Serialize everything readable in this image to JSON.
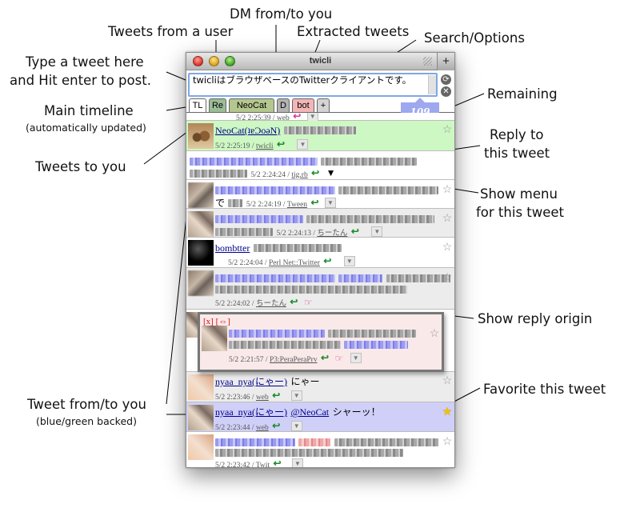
{
  "window": {
    "title": "twicli",
    "add_button": "+",
    "compose_text": "twicliはブラウザベースのTwitterクライアントです。",
    "remaining": "109"
  },
  "tabs": [
    "TL",
    "Re",
    "NeoCat",
    "D",
    "bot",
    "+"
  ],
  "tweets": [
    {
      "meta": "5/2 2:25:39",
      "source": "web"
    },
    {
      "name": "NeoCat(ʇɐƆoǝN)",
      "meta": "5/2 2:25:19",
      "source": "twicli"
    },
    {
      "meta": "5/2 2:24:24",
      "source": "tig.rb"
    },
    {
      "meta": "5/2 2:24:19",
      "source": "Tween",
      "prefix": "で"
    },
    {
      "meta": "5/2 2:24:13",
      "source": "ちーたん"
    },
    {
      "name": "bombtter",
      "meta": "5/2 2:24:04",
      "source": "Perl Net::Twitter"
    },
    {
      "meta": "5/2 2:24:02",
      "source": "ちーたん"
    },
    {
      "meta": "5/2 2:21:57",
      "source": "P3:PeraPeraPrv"
    },
    {
      "name": "nyaa_nya(にゃー)",
      "text": "にゃー",
      "meta": "5/2 2:23:46",
      "source": "web"
    },
    {
      "name": "nyaa_nya(にゃー)",
      "mention": "@NeoCat",
      "text": "シャーッ！",
      "meta": "5/2 2:23:44",
      "source": "web"
    },
    {
      "meta": "5/2 2:23:42",
      "source": "Twit"
    }
  ],
  "popup": {
    "close": "[x]",
    "toggle": "[⇔]"
  },
  "callouts": {
    "dm": "DM from/to you",
    "user_tweets": "Tweets from a user",
    "extracted": "Extracted tweets",
    "search": "Search/Options",
    "type_line1": "Type a tweet here",
    "type_line2": "and Hit enter to post.",
    "remaining": "Remaining",
    "main_timeline": "Main timeline",
    "auto_updated": "(automatically updated)",
    "reply_line1": "Reply to",
    "reply_line2": "this tweet",
    "tweets_to_you": "Tweets to you",
    "menu_line1": "Show menu",
    "menu_line2": "for this tweet",
    "reply_origin": "Show reply origin",
    "favorite": "Favorite this tweet",
    "from_to": "Tweet from/to you",
    "backed": "(blue/green backed)"
  },
  "icons": {
    "reply": "reply-arrow-icon",
    "menu": "triangle-down-icon",
    "origin": "pointing-hand-icon",
    "star": "star-icon"
  },
  "colors": {
    "green_row": "#cdf7c3",
    "blue_row": "#cfcff8",
    "remaining_badge": "#9da8ef",
    "popup": "#fae9e9"
  }
}
